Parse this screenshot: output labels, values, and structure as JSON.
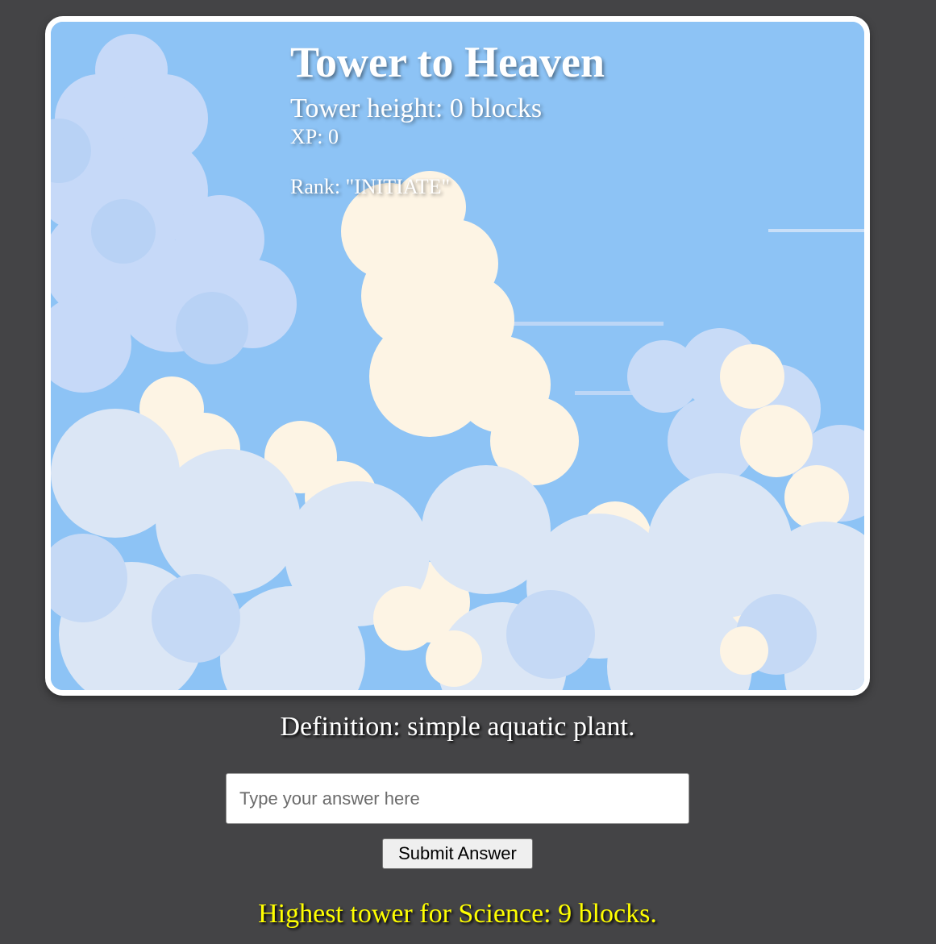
{
  "game": {
    "title": "Tower to Heaven",
    "tower_height_text": "Tower height: 0 blocks",
    "xp_text": "XP: 0",
    "rank_text": "Rank: \"INITIATE\""
  },
  "question": {
    "definition_text": "Definition: simple aquatic plant."
  },
  "answer": {
    "placeholder": "Type your answer here",
    "value": "",
    "submit_label": "Submit Answer"
  },
  "highscore": {
    "text": "Highest tower for Science: 9 blocks."
  },
  "colors": {
    "page_background": "#444446",
    "sky": "#8dc3f5",
    "frame_border": "#ffffff",
    "highscore_text": "#ffff00"
  }
}
